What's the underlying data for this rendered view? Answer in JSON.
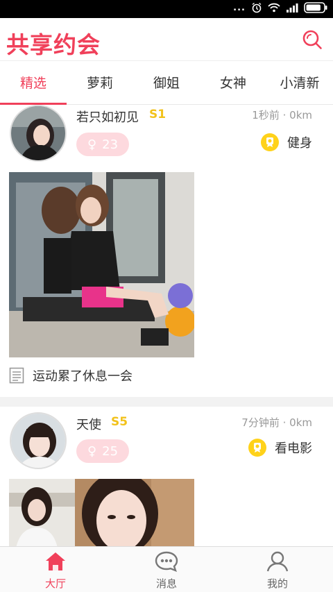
{
  "status_bar": {
    "dots": "...",
    "battery_level": 0.85
  },
  "header": {
    "title": "共享约会",
    "search_icon": "search-icon"
  },
  "tabs": [
    {
      "label": "精选",
      "active": true
    },
    {
      "label": "萝莉",
      "active": false
    },
    {
      "label": "御姐",
      "active": false
    },
    {
      "label": "女神",
      "active": false
    },
    {
      "label": "小清新",
      "active": false
    }
  ],
  "posts": [
    {
      "name": "若只如初见",
      "level": "S1",
      "meta": "1秒前 · 0km",
      "gender_symbol": "♀",
      "age": "23",
      "activity": "健身",
      "activity_icon": "badge-icon",
      "caption": "运动累了休息一会",
      "caption_icon": "note-icon"
    },
    {
      "name": "天使",
      "level": "S5",
      "meta": "7分钟前 · 0km",
      "gender_symbol": "♀",
      "age": "25",
      "activity": "看电影",
      "activity_icon": "badge-icon"
    }
  ],
  "bottom_nav": [
    {
      "label": "大厅",
      "icon": "home-icon",
      "active": true
    },
    {
      "label": "消息",
      "icon": "message-icon",
      "active": false
    },
    {
      "label": "我的",
      "icon": "profile-icon",
      "active": false
    }
  ],
  "colors": {
    "accent": "#f0405a",
    "level": "#f2c21b",
    "badge": "#ffd21a",
    "pill": "#fdd9de"
  }
}
